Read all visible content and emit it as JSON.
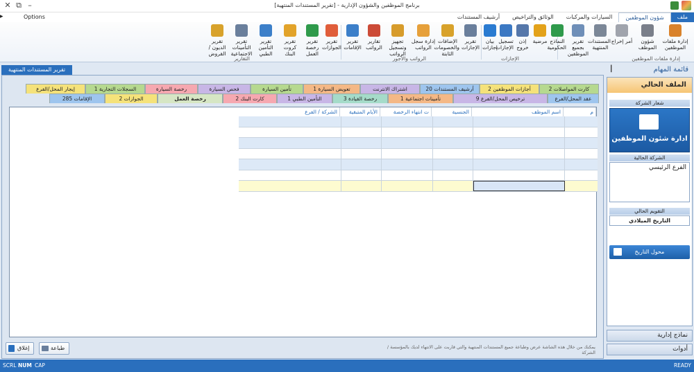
{
  "window": {
    "title": "برنامج الموظفين والشؤون الإدارية - [تقرير المستندات المنتهية]",
    "min": "–",
    "restore": "⧉",
    "close": "✕"
  },
  "menubar": {
    "options": "Options",
    "menu_icon": "▸"
  },
  "ribbon_tabs": [
    "ملف",
    "شؤون الموظفين",
    "السيارات والمركبات",
    "الوثائق والتراخيص",
    "أرشيف المستندات"
  ],
  "ribbon_buttons": [
    {
      "label": "إدارة ملفات الموظفين",
      "color": "#d9822b"
    },
    {
      "label": "شؤون الموظف",
      "color": "#7a7f8a"
    },
    {
      "label": "أمر إخراج",
      "color": "#a0a4ad"
    },
    {
      "label": "المستندات المنتهية",
      "color": "#7b8797"
    },
    {
      "label": "تقرير بجميع الموظفين",
      "color": "#6f8fb8"
    },
    {
      "label": "النماذج الحكومية",
      "color": "#2f9a4b"
    },
    {
      "label": "مرضية",
      "color": "#e3a21a"
    },
    {
      "label": "إذن خروج",
      "color": "#5577aa"
    },
    {
      "label": "تسجيل الإجازات",
      "color": "#3b78c3"
    },
    {
      "label": "بيان إجازات",
      "color": "#2a7bd1"
    },
    {
      "label": "تقرير الإجازات",
      "color": "#6a7f9c"
    },
    {
      "label": "الإضافات والخصومات الثابتة",
      "color": "#d8a22b"
    },
    {
      "label": "إدارة سجل الرواتب",
      "color": "#e6a03a"
    },
    {
      "label": "تجهيز وتسجيل الرواتب",
      "color": "#d79c2b"
    },
    {
      "label": "تقارير الرواتب",
      "color": "#cc4b37"
    },
    {
      "label": "تقرير الإقامات",
      "color": "#3c7fc9"
    },
    {
      "label": "تقرير الجوازات",
      "color": "#e05d3a"
    },
    {
      "label": "تقرير رخصة العمل",
      "color": "#2f9a4b"
    },
    {
      "label": "تقرير كروت البنك",
      "color": "#e2a32a"
    },
    {
      "label": "تقرير التأمين الطبي",
      "color": "#3c7fc9"
    },
    {
      "label": "تقرير التأمينات الاجتماعية",
      "color": "#6a7f9c"
    },
    {
      "label": "تقرير الديون / القروض",
      "color": "#d8a22b"
    }
  ],
  "ribbon_groups": [
    "إدارة ملفات الموظفين",
    "الإجازات",
    "الرواتب والأجور",
    "التقارير"
  ],
  "doc_tab": "تقرير المستندات المنتهية",
  "category_rows": [
    [
      {
        "label": "كارت المواصلات 2",
        "color": "#b6d98f"
      },
      {
        "label": "أجازات الموظفين 2",
        "color": "#f5e27a"
      },
      {
        "label": "أرشيف المستندات 20",
        "color": "#9ec5ee"
      },
      {
        "label": "اشتراك الانترنت",
        "color": "#c8b6e6"
      },
      {
        "label": "تعويض السيارة 1",
        "color": "#f4b886"
      },
      {
        "label": "تأمين السيارة",
        "color": "#b6d98f"
      },
      {
        "label": "فحص السيارة",
        "color": "#c8b6e6"
      },
      {
        "label": "رخصة السيارة",
        "color": "#f6a8b0"
      },
      {
        "label": "السجلات التجارية 1",
        "color": "#b6d98f"
      },
      {
        "label": "إيجار المحل/الفرع",
        "color": "#f5e27a"
      }
    ],
    [
      {
        "label": "عقد المحل/الفرع",
        "color": "#9ec5ee"
      },
      {
        "label": "ترخيص المحل/الفرع 9",
        "color": "#c8b6e6"
      },
      {
        "label": "تأمينات اجتماعية 1",
        "color": "#f4b886"
      },
      {
        "label": "رخصة القيادة 3",
        "color": "#a5dbc9"
      },
      {
        "label": "التأمين الطبي 1",
        "color": "#c8b6e6"
      },
      {
        "label": "كارت البنك 2",
        "color": "#f6a8b0"
      },
      {
        "label": "رخصة العمل",
        "color": "#d6e6c4"
      },
      {
        "label": "الجوازات 2",
        "color": "#f5e27a"
      },
      {
        "label": "الإقامات 285",
        "color": "#9ec5ee"
      }
    ]
  ],
  "grid": {
    "columns": [
      "م",
      "اسم الموظف",
      "الجنسية",
      "ت انتهاء الرخصة",
      "الأيام المتبقية",
      "الشركة / الفرع"
    ],
    "row_count": 7
  },
  "buttons": {
    "close": "إغلاق",
    "print": "طباعة"
  },
  "hint": "يمكنك من خلال هذه الشاشة عرض وطباعة جميع المستندات المنتهية والتي قاربت على الانتهاء لديك بالمؤسسة / الشركة",
  "task_panel": {
    "title": "قائمة المهام",
    "section": "الملف الحالي",
    "logo_label": "شعار الشركة",
    "logo_text": "ادارة شئون الموظفين",
    "company_label": "الشركة الحالية",
    "company": "الفرع الرئيسي",
    "calendar_label": "التقويم الحالي",
    "calendar": "التاريخ الميلادي",
    "convert_button": "محول التاريخ",
    "nav1": "نماذج إدارية",
    "nav2": "أدوات"
  },
  "statusbar": {
    "scrl": "SCRL",
    "num": "NUM",
    "cap": "CAP",
    "ready": "READY"
  }
}
